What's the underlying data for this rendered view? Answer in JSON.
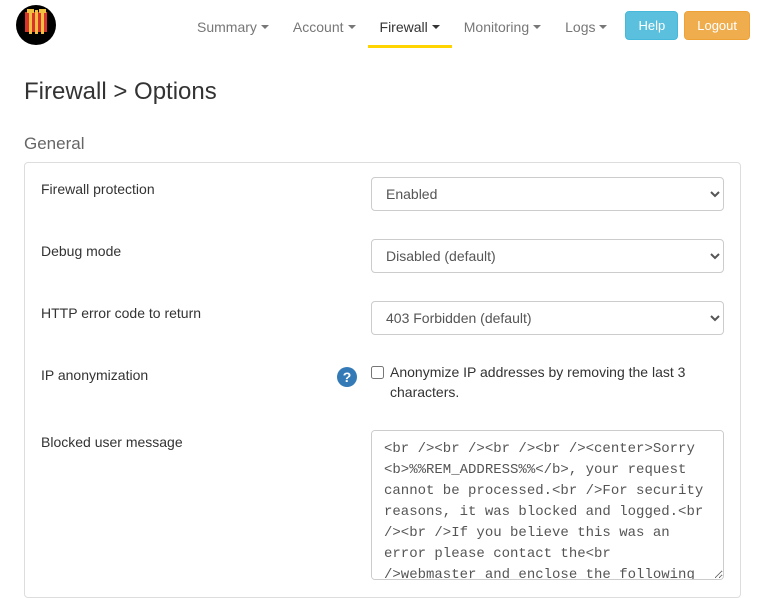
{
  "nav": {
    "items": [
      {
        "label": "Summary"
      },
      {
        "label": "Account"
      },
      {
        "label": "Firewall"
      },
      {
        "label": "Monitoring"
      },
      {
        "label": "Logs"
      }
    ],
    "help": "Help",
    "logout": "Logout"
  },
  "page": {
    "title": "Firewall > Options",
    "section": "General"
  },
  "form": {
    "firewall_protection": {
      "label": "Firewall protection",
      "value": "Enabled"
    },
    "debug_mode": {
      "label": "Debug mode",
      "value": "Disabled (default)"
    },
    "http_error": {
      "label": "HTTP error code to return",
      "value": "403 Forbidden (default)"
    },
    "ip_anon": {
      "label": "IP anonymization",
      "checkbox_label": "Anonymize IP addresses by removing the last 3 characters.",
      "checked": false
    },
    "blocked_msg": {
      "label": "Blocked user message",
      "value": "<br /><br /><br /><br /><center>Sorry <b>%%REM_ADDRESS%%</b>, your request cannot be processed.<br />For security reasons, it was blocked and logged.<br /><br />If you believe this was an error please contact the<br />webmaster and enclose the following incident ID:<br /><br />[ <b>#%%NUM_INCIDENT%%</b> ]</center>"
    }
  }
}
